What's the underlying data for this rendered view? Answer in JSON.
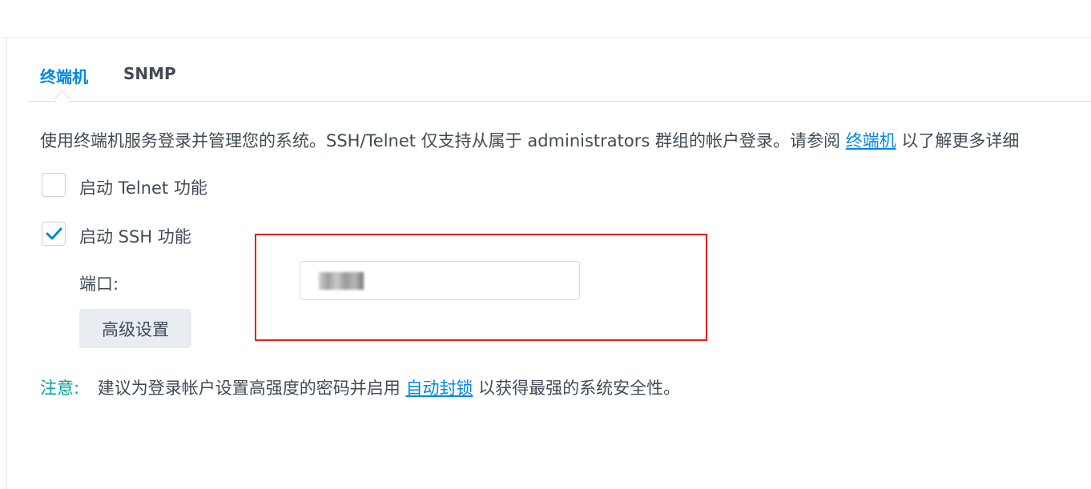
{
  "tabs": [
    {
      "label": "终端机",
      "active": true
    },
    {
      "label": "SNMP",
      "active": false
    }
  ],
  "description": {
    "text": "使用终端机服务登录并管理您的系统。SSH/Telnet 仅支持从属于 administrators 群组的帐户登录。请参阅",
    "link": "终端机",
    "suffix": "以了解更多详细"
  },
  "telnet": {
    "label": "启动 Telnet 功能",
    "checked": false
  },
  "ssh": {
    "label": "启动 SSH 功能",
    "checked": true
  },
  "port": {
    "label": "端口:",
    "value": ""
  },
  "advanced_button": "高级设置",
  "note": {
    "label": "注意:",
    "text": "建议为登录帐户设置高强度的密码并启用",
    "link": "自动封锁",
    "suffix": "以获得最强的系统安全性。"
  },
  "colors": {
    "accent": "#0086e5",
    "note": "#00a29a",
    "highlight": "#e02020"
  }
}
